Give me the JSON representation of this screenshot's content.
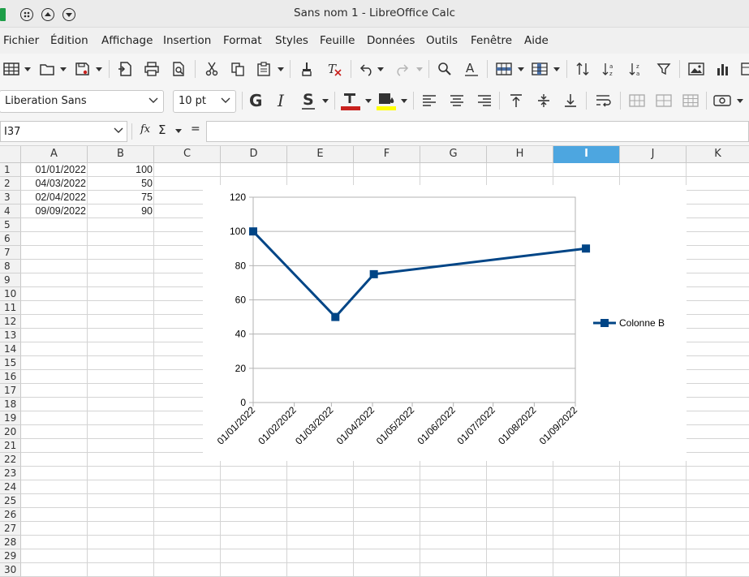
{
  "window": {
    "title": "Sans nom 1 - LibreOffice Calc"
  },
  "menu": [
    "Fichier",
    "Édition",
    "Affichage",
    "Insertion",
    "Format",
    "Styles",
    "Feuille",
    "Données",
    "Outils",
    "Fenêtre",
    "Aide"
  ],
  "format_bar": {
    "font_name": "Liberation Sans",
    "font_size": "10 pt"
  },
  "formula_bar": {
    "cell_ref": "I37",
    "fx_label": "fx",
    "sum_label": "Σ",
    "equals_label": "=",
    "value": ""
  },
  "columns": [
    "A",
    "B",
    "C",
    "D",
    "E",
    "F",
    "G",
    "H",
    "I",
    "J",
    "K"
  ],
  "active_column": "I",
  "rows": [
    "1",
    "2",
    "3",
    "4",
    "5",
    "6",
    "7",
    "8",
    "9",
    "10",
    "11",
    "12",
    "13",
    "14",
    "15",
    "16",
    "17",
    "18",
    "19",
    "20",
    "21",
    "22",
    "23",
    "24",
    "25",
    "26",
    "27",
    "28",
    "29",
    "30"
  ],
  "sheet": {
    "A": [
      "01/01/2022",
      "04/03/2022",
      "02/04/2022",
      "09/09/2022"
    ],
    "B": [
      "100",
      "50",
      "75",
      "90"
    ]
  },
  "chart_data": {
    "type": "line",
    "x": [
      "01/01/2022",
      "04/03/2022",
      "02/04/2022",
      "09/09/2022"
    ],
    "series": [
      {
        "name": "Colonne B",
        "values": [
          100,
          50,
          75,
          90
        ],
        "color": "#004586"
      }
    ],
    "x_ticks": [
      "01/01/2022",
      "01/02/2022",
      "01/03/2022",
      "01/04/2022",
      "01/05/2022",
      "01/06/2022",
      "01/07/2022",
      "01/08/2022",
      "01/09/2022"
    ],
    "y_ticks": [
      "0",
      "20",
      "40",
      "60",
      "80",
      "100",
      "120"
    ],
    "ylim": [
      0,
      120
    ],
    "xlim": [
      "01/01/2022",
      "01/09/2022"
    ],
    "grid": true,
    "legend_position": "right"
  },
  "colors": {
    "accent": "#4da6e0",
    "series": "#004586",
    "font_red": "#c9211e",
    "highlight_yellow": "#ffff00"
  }
}
